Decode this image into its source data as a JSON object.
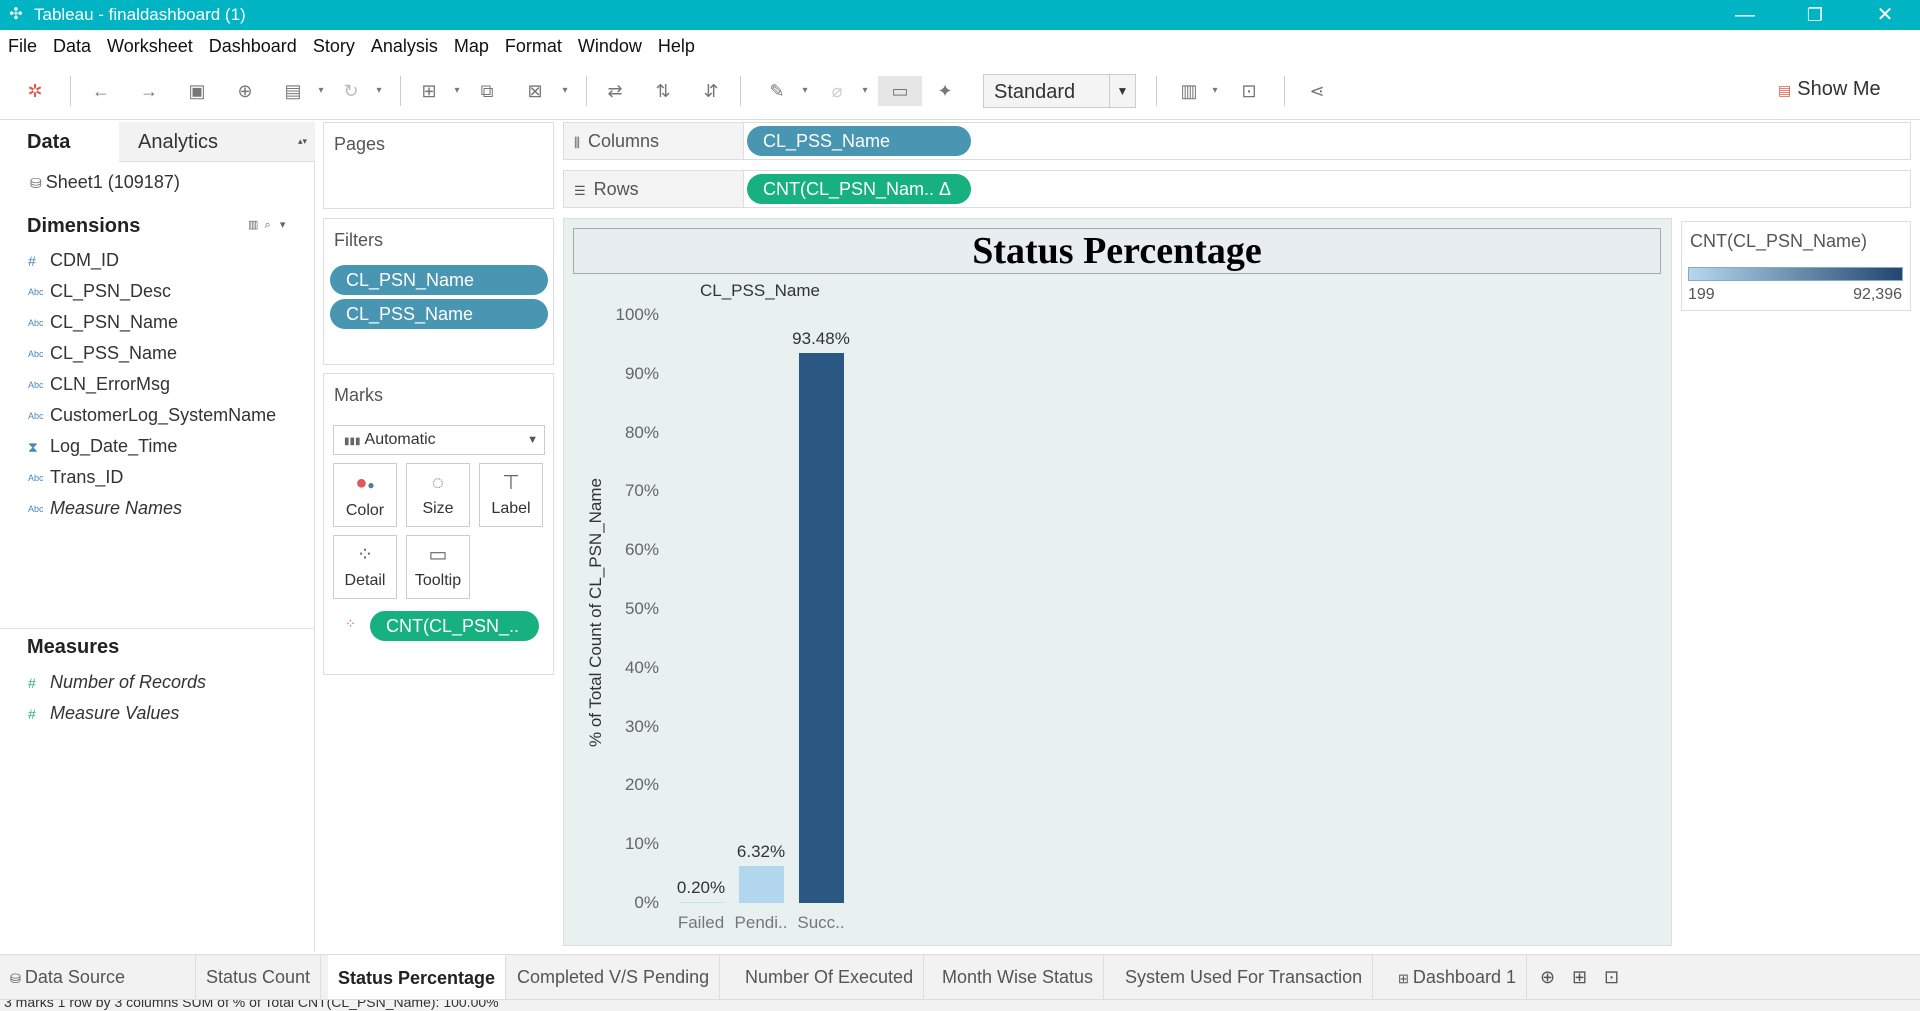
{
  "window": {
    "title": "Tableau - finaldashboard (1)",
    "minimize": "—",
    "restore": "❐",
    "close": "✕"
  },
  "menu": [
    "File",
    "Data",
    "Worksheet",
    "Dashboard",
    "Story",
    "Analysis",
    "Map",
    "Format",
    "Window",
    "Help"
  ],
  "toolbar": {
    "fit_select": "Standard",
    "show_me": "Show Me"
  },
  "data_pane": {
    "tab_data": "Data",
    "tab_analytics": "Analytics",
    "datasource": "Sheet1 (109187)",
    "dimensions_title": "Dimensions",
    "dimensions": [
      {
        "type": "#",
        "name": "CDM_ID"
      },
      {
        "type": "Abc",
        "name": "CL_PSN_Desc"
      },
      {
        "type": "Abc",
        "name": "CL_PSN_Name"
      },
      {
        "type": "Abc",
        "name": "CL_PSS_Name"
      },
      {
        "type": "Abc",
        "name": "CLN_ErrorMsg"
      },
      {
        "type": "Abc",
        "name": "CustomerLog_SystemName"
      },
      {
        "type": "date",
        "name": "Log_Date_Time"
      },
      {
        "type": "Abc",
        "name": "Trans_ID"
      },
      {
        "type": "Abc",
        "name": "Measure Names"
      }
    ],
    "measures_title": "Measures",
    "measures": [
      {
        "type": "#",
        "name": "Number of Records"
      },
      {
        "type": "#",
        "name": "Measure Values"
      }
    ]
  },
  "pages": {
    "title": "Pages"
  },
  "filters": {
    "title": "Filters",
    "pills": [
      "CL_PSN_Name",
      "CL_PSS_Name"
    ]
  },
  "marks": {
    "title": "Marks",
    "type": "Automatic",
    "buttons": {
      "color": "Color",
      "size": "Size",
      "label": "Label",
      "detail": "Detail",
      "tooltip": "Tooltip"
    },
    "color_pill": "CNT(CL_PSN_.."
  },
  "shelves": {
    "columns_label": "Columns",
    "columns_pill": "CL_PSS_Name",
    "rows_label": "Rows",
    "rows_pill": "CNT(CL_PSN_Nam.. Δ"
  },
  "chart_data": {
    "type": "bar",
    "title": "Status Percentage",
    "column_header": "CL_PSS_Name",
    "ylabel": "% of Total Count of CL_PSN_Name",
    "categories": [
      "Failed",
      "Pendi..",
      "Succ.."
    ],
    "values": [
      0.2,
      6.32,
      93.48
    ],
    "value_labels": [
      "0.20%",
      "6.32%",
      "93.48%"
    ],
    "bar_colors": [
      "#c9e0f1",
      "#b3d6ef",
      "#2a5883"
    ],
    "ylim": [
      0,
      100
    ],
    "yticks": [
      "0%",
      "10%",
      "20%",
      "30%",
      "40%",
      "50%",
      "60%",
      "70%",
      "80%",
      "90%",
      "100%"
    ],
    "grid": false
  },
  "legend": {
    "title": "CNT(CL_PSN_Name)",
    "min": "199",
    "max": "92,396"
  },
  "sheet_tabs": {
    "data_source": "Data Source",
    "tabs": [
      "Status Count",
      "Status Percentage",
      "Completed V/S Pending",
      "Number Of Executed",
      "Month Wise Status",
      "System Used For Transaction",
      "Dashboard 1"
    ],
    "active": "Status Percentage"
  },
  "status_bar": "3 marks   1 row by 3 columns   SUM of % of Total CNT(CL_PSN_Name): 100.00%"
}
